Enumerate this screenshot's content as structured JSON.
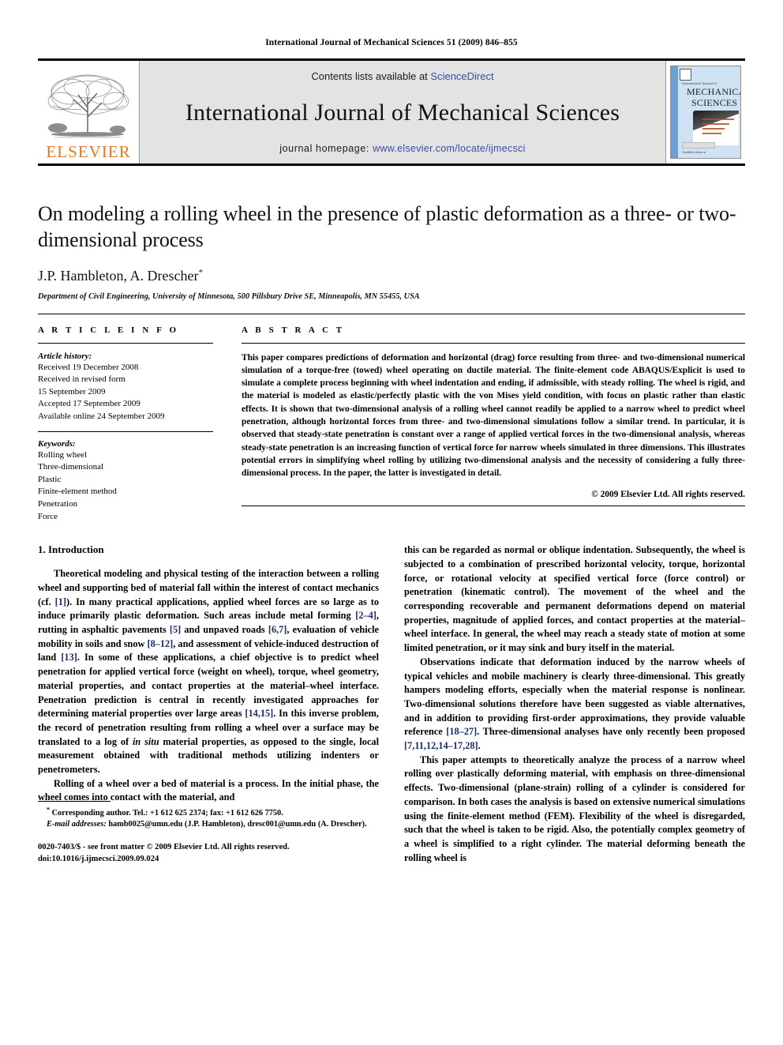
{
  "running_head": "International Journal of Mechanical Sciences 51 (2009) 846–855",
  "masthead": {
    "publisher_name": "ELSEVIER",
    "contents_prefix": "Contents lists available at ",
    "contents_link": "ScienceDirect",
    "journal_title": "International Journal of Mechanical Sciences",
    "homepage_prefix": "journal homepage: ",
    "homepage_url": "www.elsevier.com/locate/ijmecsci",
    "cover": {
      "kicker": "International Journal of",
      "line1": "MECHANICAL",
      "line2": "SCIENCES",
      "footer": "Available online at",
      "link_color": "#3b4ca8",
      "brand_color": "#E87722",
      "band_color": "#e3e3e3"
    }
  },
  "article": {
    "title": "On modeling a rolling wheel in the presence of plastic deformation as a three- or two-dimensional process",
    "authors": "J.P. Hambleton, A. Drescher",
    "corresponding_marker": "*",
    "affiliation": "Department of Civil Engineering, University of Minnesota, 500 Pillsbury Drive SE, Minneapolis, MN 55455, USA"
  },
  "article_info": {
    "heading": "A R T I C L E   I N F O",
    "history_label": "Article history:",
    "history": [
      "Received 19 December 2008",
      "Received in revised form",
      "15 September 2009",
      "Accepted 17 September 2009",
      "Available online 24 September 2009"
    ],
    "keywords_label": "Keywords:",
    "keywords": [
      "Rolling wheel",
      "Three-dimensional",
      "Plastic",
      "Finite-element method",
      "Penetration",
      "Force"
    ]
  },
  "abstract": {
    "heading": "A B S T R A C T",
    "text": "This paper compares predictions of deformation and horizontal (drag) force resulting from three- and two-dimensional numerical simulation of a torque-free (towed) wheel operating on ductile material. The finite-element code ABAQUS/Explicit is used to simulate a complete process beginning with wheel indentation and ending, if admissible, with steady rolling. The wheel is rigid, and the material is modeled as elastic/perfectly plastic with the von Mises yield condition, with focus on plastic rather than elastic effects. It is shown that two-dimensional analysis of a rolling wheel cannot readily be applied to a narrow wheel to predict wheel penetration, although horizontal forces from three- and two-dimensional simulations follow a similar trend. In particular, it is observed that steady-state penetration is constant over a range of applied vertical forces in the two-dimensional analysis, whereas steady-state penetration is an increasing function of vertical force for narrow wheels simulated in three dimensions. This illustrates potential errors in simplifying wheel rolling by utilizing two-dimensional analysis and the necessity of considering a fully three-dimensional process. In the paper, the latter is investigated in detail.",
    "copyright": "© 2009 Elsevier Ltd. All rights reserved."
  },
  "body": {
    "section_number": "1.",
    "section_title": "Introduction",
    "left_paragraphs": [
      {
        "segments": [
          {
            "t": "Theoretical modeling and physical testing of the interaction between a rolling wheel and supporting bed of material fall within the interest of contact mechanics (cf. "
          },
          {
            "t": "[1]",
            "k": "ref"
          },
          {
            "t": "). In many practical applications, applied wheel forces are so large as to induce primarily plastic deformation. Such areas include metal forming "
          },
          {
            "t": "[2–4]",
            "k": "ref"
          },
          {
            "t": ", rutting in asphaltic pavements "
          },
          {
            "t": "[5]",
            "k": "ref"
          },
          {
            "t": " and unpaved roads "
          },
          {
            "t": "[6,7]",
            "k": "ref"
          },
          {
            "t": ", evaluation of vehicle mobility in soils and snow "
          },
          {
            "t": "[8–12]",
            "k": "ref"
          },
          {
            "t": ", and assessment of vehicle-induced destruction of land "
          },
          {
            "t": "[13]",
            "k": "ref"
          },
          {
            "t": ". In some of these applications, a chief objective is to predict wheel penetration for applied vertical force (weight on wheel), torque, wheel geometry, material properties, and contact properties at the material–wheel interface. Penetration prediction is central in recently investigated approaches for determining material properties over large areas "
          },
          {
            "t": "[14,15]",
            "k": "ref"
          },
          {
            "t": ". In this inverse problem, the record of penetration resulting from rolling a wheel over a surface may be translated to a log of "
          },
          {
            "t": "in situ",
            "k": "ital"
          },
          {
            "t": " material properties, as opposed to the single, local measurement obtained with traditional methods utilizing indenters or penetrometers."
          }
        ]
      },
      {
        "segments": [
          {
            "t": "Rolling of a wheel over a bed of material is a process. In the initial phase, the wheel comes into contact with the material, and"
          }
        ]
      }
    ],
    "right_paragraphs": [
      {
        "continued": true,
        "segments": [
          {
            "t": "this can be regarded as normal or oblique indentation. Subsequently, the wheel is subjected to a combination of prescribed horizontal velocity, torque, horizontal force, or rotational velocity at specified vertical force (force control) or penetration (kinematic control). The movement of the wheel and the corresponding recoverable and permanent deformations depend on material properties, magnitude of applied forces, and contact properties at the material–wheel interface. In general, the wheel may reach a steady state of motion at some limited penetration, or it may sink and bury itself in the material."
          }
        ]
      },
      {
        "segments": [
          {
            "t": "Observations indicate that deformation induced by the narrow wheels of typical vehicles and mobile machinery is clearly three-dimensional. This greatly hampers modeling efforts, especially when the material response is nonlinear. Two-dimensional solutions therefore have been suggested as viable alternatives, and in addition to providing first-order approximations, they provide valuable reference "
          },
          {
            "t": "[18–27]",
            "k": "ref"
          },
          {
            "t": ". Three-dimensional analyses have only recently been proposed "
          },
          {
            "t": "[7,11,12,14–17,28]",
            "k": "ref"
          },
          {
            "t": "."
          }
        ]
      },
      {
        "segments": [
          {
            "t": "This paper attempts to theoretically analyze the process of a narrow wheel rolling over plastically deforming material, with emphasis on three-dimensional effects. Two-dimensional (plane-strain) rolling of a cylinder is considered for comparison. In both cases the analysis is based on extensive numerical simulations using the finite-element method (FEM). Flexibility of the wheel is disregarded, such that the wheel is taken to be rigid. Also, the potentially complex geometry of a wheel is simplified to a right cylinder. The material deforming beneath the rolling wheel is"
          }
        ]
      }
    ]
  },
  "footnotes": {
    "corresponding": "Corresponding author. Tel.: +1 612 625 2374; fax: +1 612 626 7750.",
    "email_label": "E-mail addresses:",
    "email_text": " hamb0025@umn.edu (J.P. Hambleton), dresc001@umn.edu (A. Drescher).",
    "issn_line": "0020-7403/$ - see front matter © 2009 Elsevier Ltd. All rights reserved.",
    "doi_line": "doi:10.1016/j.ijmecsci.2009.09.024"
  }
}
